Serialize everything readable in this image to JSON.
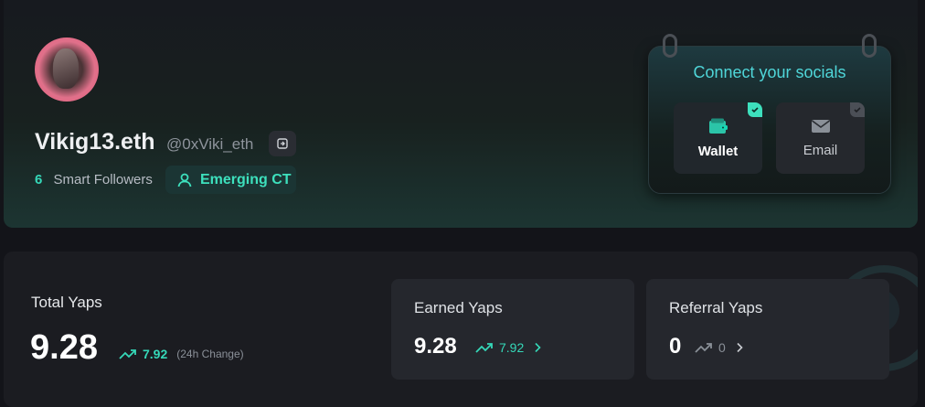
{
  "profile": {
    "display_name": "Vikig13.eth",
    "handle": "@0xViki_eth",
    "smart_followers_count": "6",
    "smart_followers_label": "Smart Followers",
    "badge_label": "Emerging CT"
  },
  "socials": {
    "title": "Connect your socials",
    "wallet_label": "Wallet",
    "email_label": "Email"
  },
  "stats": {
    "total_label": "Total Yaps",
    "total_value": "9.28",
    "total_change": "7.92",
    "total_change_note": "(24h Change)",
    "earned_label": "Earned Yaps",
    "earned_value": "9.28",
    "earned_change": "7.92",
    "referral_label": "Referral Yaps",
    "referral_value": "0",
    "referral_change": "0"
  },
  "colors": {
    "accent": "#35d8b8",
    "background": "#131419",
    "card": "#1b1c21"
  }
}
